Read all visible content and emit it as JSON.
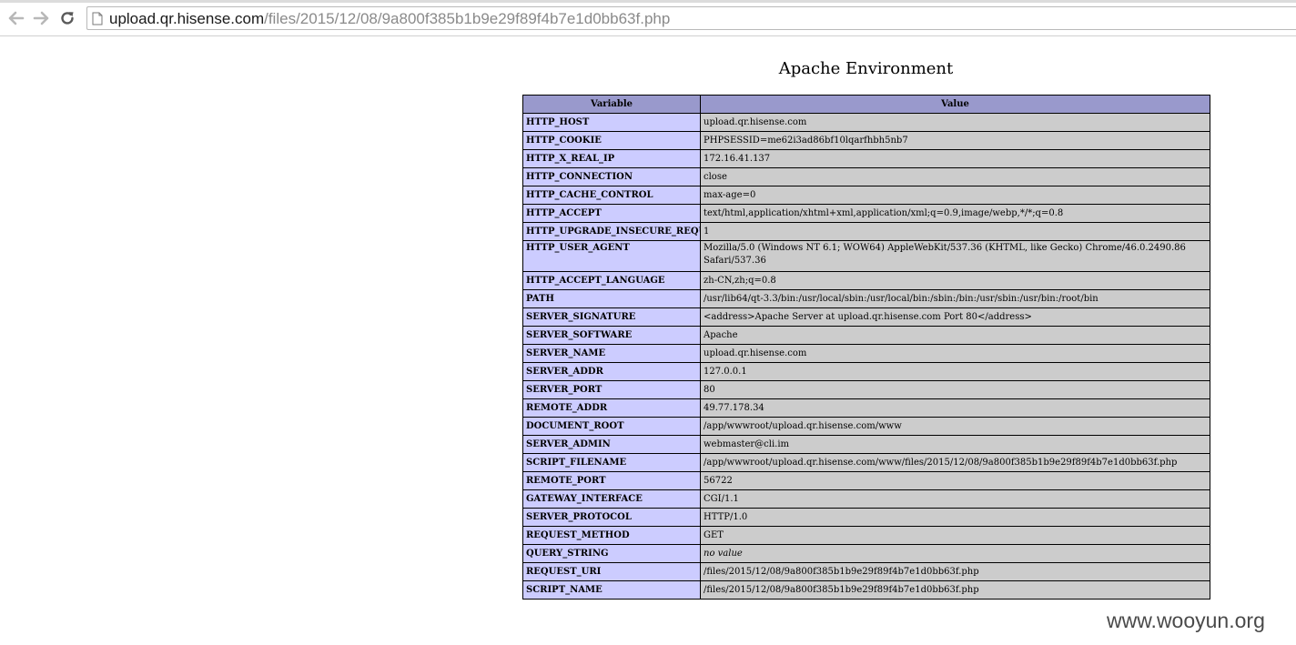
{
  "browser": {
    "url_host": "upload.qr.hisense.com",
    "url_path": "/files/2015/12/08/9a800f385b1b9e29f89f4b7e1d0bb63f.php"
  },
  "page": {
    "title": "Apache Environment",
    "columns": [
      "Variable",
      "Value"
    ],
    "rows": [
      {
        "name": "HTTP_HOST",
        "value": "upload.qr.hisense.com"
      },
      {
        "name": "HTTP_COOKIE",
        "value": "PHPSESSID=me62i3ad86bf10lqarfhbh5nb7"
      },
      {
        "name": "HTTP_X_REAL_IP",
        "value": "172.16.41.137"
      },
      {
        "name": "HTTP_CONNECTION",
        "value": "close"
      },
      {
        "name": "HTTP_CACHE_CONTROL",
        "value": "max-age=0"
      },
      {
        "name": "HTTP_ACCEPT",
        "value": "text/html,application/xhtml+xml,application/xml;q=0.9,image/webp,*/*;q=0.8"
      },
      {
        "name": "HTTP_UPGRADE_INSECURE_REQUESTS",
        "value": "1"
      },
      {
        "name": "HTTP_USER_AGENT",
        "value": "Mozilla/5.0 (Windows NT 6.1; WOW64) AppleWebKit/537.36 (KHTML, like Gecko) Chrome/46.0.2490.86 Safari/537.36"
      },
      {
        "name": "HTTP_ACCEPT_LANGUAGE",
        "value": "zh-CN,zh;q=0.8"
      },
      {
        "name": "PATH",
        "value": "/usr/lib64/qt-3.3/bin:/usr/local/sbin:/usr/local/bin:/sbin:/bin:/usr/sbin:/usr/bin:/root/bin"
      },
      {
        "name": "SERVER_SIGNATURE",
        "value": "<address>Apache Server at upload.qr.hisense.com Port 80</address>"
      },
      {
        "name": "SERVER_SOFTWARE",
        "value": "Apache"
      },
      {
        "name": "SERVER_NAME",
        "value": "upload.qr.hisense.com"
      },
      {
        "name": "SERVER_ADDR",
        "value": "127.0.0.1"
      },
      {
        "name": "SERVER_PORT",
        "value": "80"
      },
      {
        "name": "REMOTE_ADDR",
        "value": "49.77.178.34"
      },
      {
        "name": "DOCUMENT_ROOT",
        "value": "/app/wwwroot/upload.qr.hisense.com/www"
      },
      {
        "name": "SERVER_ADMIN",
        "value": "webmaster@cli.im"
      },
      {
        "name": "SCRIPT_FILENAME",
        "value": "/app/wwwroot/upload.qr.hisense.com/www/files/2015/12/08/9a800f385b1b9e29f89f4b7e1d0bb63f.php"
      },
      {
        "name": "REMOTE_PORT",
        "value": "56722"
      },
      {
        "name": "GATEWAY_INTERFACE",
        "value": "CGI/1.1"
      },
      {
        "name": "SERVER_PROTOCOL",
        "value": "HTTP/1.0"
      },
      {
        "name": "REQUEST_METHOD",
        "value": "GET"
      },
      {
        "name": "QUERY_STRING",
        "value": "no value"
      },
      {
        "name": "REQUEST_URI",
        "value": "/files/2015/12/08/9a800f385b1b9e29f89f4b7e1d0bb63f.php"
      },
      {
        "name": "SCRIPT_NAME",
        "value": "/files/2015/12/08/9a800f385b1b9e29f89f4b7e1d0bb63f.php"
      }
    ]
  },
  "watermark": "www.wooyun.org",
  "colors": {
    "header_bg": "#9999cc",
    "var_bg": "#ccccff",
    "value_bg": "#cccccc"
  },
  "icons": {
    "back": "back-arrow-icon",
    "forward": "forward-arrow-icon",
    "reload": "reload-icon",
    "page": "page-icon"
  }
}
